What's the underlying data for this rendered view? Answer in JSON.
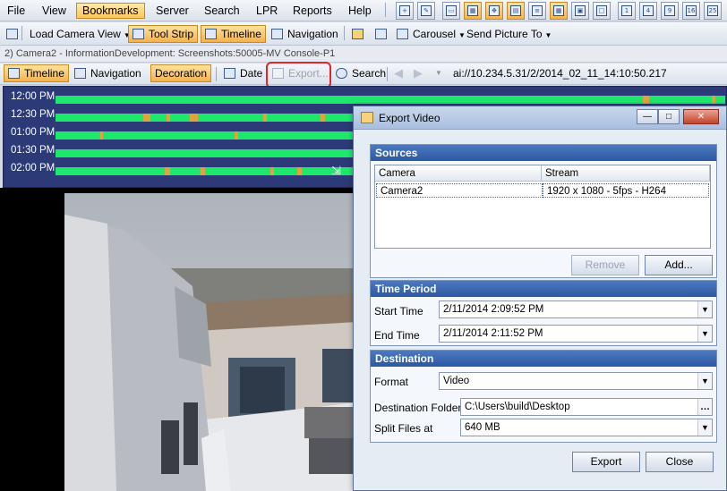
{
  "menu": [
    "File",
    "View",
    "Bookmarks",
    "Server",
    "Search",
    "LPR",
    "Reports",
    "Help"
  ],
  "menu_active": "Bookmarks",
  "toolbar1": {
    "load_camera_view": "Load Camera View",
    "tool_strip": "Tool Strip",
    "timeline": "Timeline",
    "navigation": "Navigation",
    "carousel": "Carousel",
    "send_picture_to": "Send Picture To"
  },
  "window_title": "2) Camera2 - InformationDevelopment: Screenshots:50005-MV Console-P1",
  "toolbar2": {
    "timeline": "Timeline",
    "navigation": "Navigation",
    "decoration": "Decoration",
    "date": "Date",
    "export": "Export...",
    "search": "Search",
    "address": "ai://10.234.5.31/2/2014_02_11_14:10:50.217"
  },
  "timeline_rows": [
    "12:00 PM",
    "12:30 PM",
    "01:00 PM",
    "01:30 PM",
    "02:00 PM"
  ],
  "dialog": {
    "title": "Export Video",
    "sources": {
      "heading": "Sources",
      "col_camera": "Camera",
      "col_stream": "Stream",
      "row_camera": "Camera2",
      "row_stream": "1920 x 1080 - 5fps - H264",
      "remove": "Remove",
      "add": "Add..."
    },
    "time_period": {
      "heading": "Time Period",
      "start_label": "Start Time",
      "start_value": "2/11/2014 2:09:52 PM",
      "end_label": "End Time",
      "end_value": "2/11/2014 2:11:52 PM"
    },
    "destination": {
      "heading": "Destination",
      "format_label": "Format",
      "format_value": "Video",
      "folder_label": "Destination Folder",
      "folder_value": "C:\\Users\\build\\Desktop",
      "split_label": "Split Files at",
      "split_value": "640 MB"
    },
    "export_button": "Export",
    "close_button": "Close"
  },
  "colors": {
    "accent_orange": "#f3b24e",
    "timeline_bg": "#2c3a78",
    "timeline_green": "#1ee86c",
    "timeline_event": "#e2a43a",
    "callout_red": "#e0262a",
    "group_header": "#2b58a3"
  },
  "icons": [
    "save-icon",
    "camera-view-icon",
    "lock-icon",
    "carousel-icon",
    "search-icon",
    "back-arrow-icon",
    "forward-arrow-icon",
    "calendar-icon",
    "export-icon"
  ]
}
